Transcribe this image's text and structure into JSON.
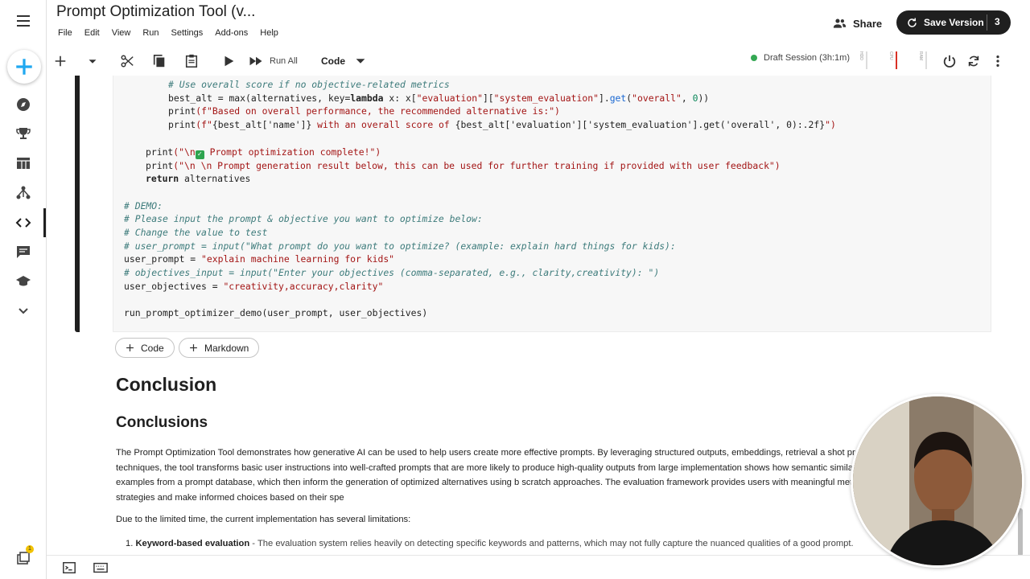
{
  "header": {
    "title": "Prompt Optimization Tool (v...",
    "menu": [
      "File",
      "Edit",
      "View",
      "Run",
      "Settings",
      "Add-ons",
      "Help"
    ],
    "share_label": "Share",
    "save_label": "Save Version",
    "version_count": "3"
  },
  "toolbar": {
    "run_all_label": "Run All",
    "cell_type": "Code",
    "session_status": "Draft Session (3h:1m)",
    "meters": [
      "HDD",
      "CPU",
      "RAM"
    ]
  },
  "code_lines": {
    "l1": "# Use overall score if no objective-related metrics",
    "l2a": "best_alt = ",
    "l2b": "max",
    "l2c": "(alternatives, key=",
    "l2d": "lambda",
    "l2e": " x: x[",
    "l2f": "\"evaluation\"",
    "l2g": "][",
    "l2h": "\"system_evaluation\"",
    "l2i": "].",
    "l2j": "get",
    "l2k": "(",
    "l2l": "\"overall\"",
    "l2m": ", ",
    "l2n": "0",
    "l2o": "))",
    "l3a": "print",
    "l3b": "(f\"Based on overall performance, the recommended alternative is:\")",
    "l4a": "print",
    "l4b": "(f\"",
    "l4c": "{best_alt['name']}",
    "l4d": " with an overall score of ",
    "l4e": "{best_alt['evaluation']['system_evaluation'].get('overall', 0):.2f}",
    "l4f": "\")",
    "l5a": "print",
    "l5b": "(\"\\n",
    "l5c": " Prompt optimization complete!\")",
    "l6a": "print",
    "l6b": "(\"\\n \\n Prompt generation result below, this can be used for further training if provided with user feedback\")",
    "l7a": "return",
    "l7b": " alternatives",
    "l8": "# DEMO:",
    "l9": "# Please input the prompt & objective you want to optimize below:",
    "l10": "# Change the value to test",
    "l11": "# user_prompt = input(\"What prompt do you want to optimize? (example: explain hard things for kids):",
    "l12a": "user_prompt = ",
    "l12b": "\"explain machine learning for kids\"",
    "l13": "# objectives_input = input(\"Enter your objectives (comma-separated, e.g., clarity,creativity): \")",
    "l14a": "user_objectives = ",
    "l14b": "\"creativity,accuracy,clarity\"",
    "l15": "run_prompt_optimizer_demo(user_prompt, user_objectives)"
  },
  "add_cell": {
    "code_label": "Code",
    "markdown_label": "Markdown"
  },
  "markdown": {
    "h1": "Conclusion",
    "h2": "Conclusions",
    "para": "The Prompt Optimization Tool demonstrates how generative AI can be used to help users create more effective prompts. By leveraging structured outputs, embeddings, retrieval a shot prompting, and AI evaluation techniques, the tool transforms basic user instructions into well-crafted prompts that are more likely to produce high-quality outputs from large implementation shows how semantic similarity search can identify relevant examples from a prompt database, which then inform the generation of optimized alternatives using b scratch approaches. The evaluation framework provides users with meaningful metrics to compare different optimization strategies and make informed choices based on their spe",
    "para2": "Due to the limited time, the current implementation has several limitations:",
    "li_num": "1.",
    "li_bold": "Keyword-based evaluation",
    "li_text": " - The evaluation system relies heavily on detecting specific keywords and patterns, which may not fully capture the nuanced qualities of a good prompt."
  },
  "rail": {
    "badge": "1"
  },
  "colors": {
    "accent": "#1f1f1f",
    "session_dot": "#34a853",
    "string": "#a31515",
    "comment": "#3d7b7b"
  }
}
